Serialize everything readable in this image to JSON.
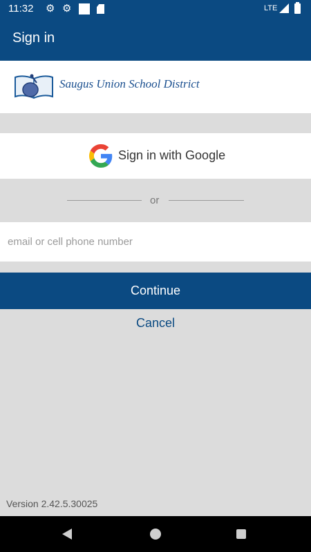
{
  "status_bar": {
    "time": "11:32",
    "network": "LTE",
    "icons": [
      "gear-icon",
      "gear-icon",
      "square-icon",
      "sd-card-icon",
      "signal-icon",
      "battery-icon"
    ]
  },
  "app_bar": {
    "title": "Sign in"
  },
  "district": {
    "name": "Saugus Union School District"
  },
  "google_button": {
    "label": "Sign in with Google"
  },
  "divider": {
    "text": "or"
  },
  "email_field": {
    "placeholder": "email or cell phone number",
    "value": ""
  },
  "continue_button": {
    "label": "Continue"
  },
  "cancel_link": {
    "label": "Cancel"
  },
  "footer": {
    "version": "Version 2.42.5.30025"
  },
  "colors": {
    "brand": "#0b4a82",
    "background": "#dcdcdc",
    "panel": "#ffffff"
  }
}
